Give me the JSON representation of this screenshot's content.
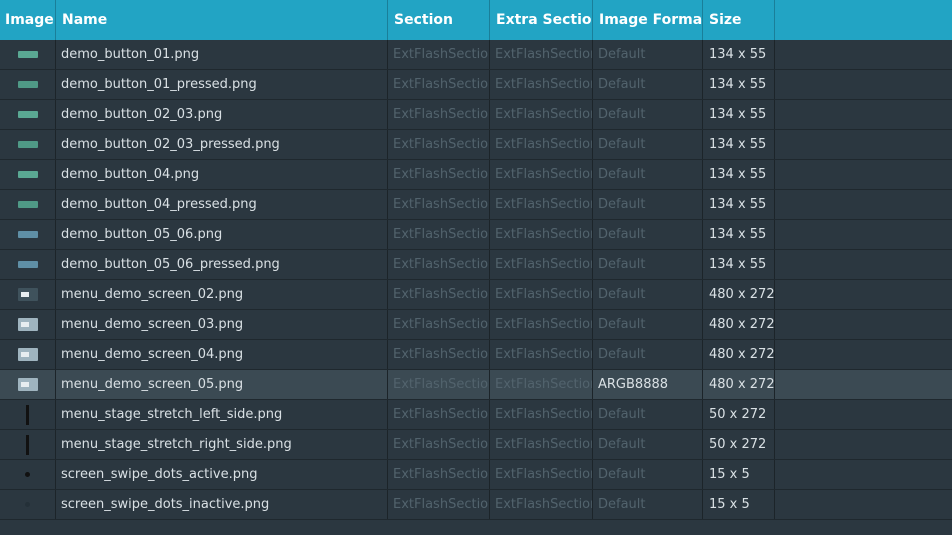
{
  "headers": {
    "image": "Image",
    "name": "Name",
    "section": "Section",
    "extra_section": "Extra Section",
    "image_format": "Image Format",
    "size": "Size"
  },
  "colors": {
    "header_bg": "#22a4c4",
    "row_bg": "#2b3740",
    "selected_row_bg": "#3b4a53",
    "muted_text": "#52636d",
    "text": "#d9e0e4"
  },
  "rows": [
    {
      "thumb": "button-thumbnail",
      "name": "demo_button_01.png",
      "section": "ExtFlashSection",
      "extra_section": "ExtFlashSection",
      "format": "Default",
      "size": "134 x 55"
    },
    {
      "thumb": "button-pressed-thumbnail",
      "name": "demo_button_01_pressed.png",
      "section": "ExtFlashSection",
      "extra_section": "ExtFlashSection",
      "format": "Default",
      "size": "134 x 55"
    },
    {
      "thumb": "button-thumbnail",
      "name": "demo_button_02_03.png",
      "section": "ExtFlashSection",
      "extra_section": "ExtFlashSection",
      "format": "Default",
      "size": "134 x 55"
    },
    {
      "thumb": "button-pressed-thumbnail",
      "name": "demo_button_02_03_pressed.png",
      "section": "ExtFlashSection",
      "extra_section": "ExtFlashSection",
      "format": "Default",
      "size": "134 x 55"
    },
    {
      "thumb": "button-thumbnail",
      "name": "demo_button_04.png",
      "section": "ExtFlashSection",
      "extra_section": "ExtFlashSection",
      "format": "Default",
      "size": "134 x 55"
    },
    {
      "thumb": "button-pressed-thumbnail",
      "name": "demo_button_04_pressed.png",
      "section": "ExtFlashSection",
      "extra_section": "ExtFlashSection",
      "format": "Default",
      "size": "134 x 55"
    },
    {
      "thumb": "button-blue-thumbnail",
      "name": "demo_button_05_06.png",
      "section": "ExtFlashSection",
      "extra_section": "ExtFlashSection",
      "format": "Default",
      "size": "134 x 55"
    },
    {
      "thumb": "button-blue-thumbnail",
      "name": "demo_button_05_06_pressed.png",
      "section": "ExtFlashSection",
      "extra_section": "ExtFlashSection",
      "format": "Default",
      "size": "134 x 55"
    },
    {
      "thumb": "screen-dark-thumbnail",
      "name": "menu_demo_screen_02.png",
      "section": "ExtFlashSection",
      "extra_section": "ExtFlashSection",
      "format": "Default",
      "size": "480 x 272"
    },
    {
      "thumb": "screen-thumbnail",
      "name": "menu_demo_screen_03.png",
      "section": "ExtFlashSection",
      "extra_section": "ExtFlashSection",
      "format": "Default",
      "size": "480 x 272"
    },
    {
      "thumb": "screen-thumbnail",
      "name": "menu_demo_screen_04.png",
      "section": "ExtFlashSection",
      "extra_section": "ExtFlashSection",
      "format": "Default",
      "size": "480 x 272"
    },
    {
      "thumb": "screen-thumbnail",
      "name": "menu_demo_screen_05.png",
      "section": "ExtFlashSection",
      "extra_section": "ExtFlashSection",
      "format": "ARGB8888",
      "size": "480 x 272",
      "selected": true
    },
    {
      "thumb": "stretch-thumbnail",
      "name": "menu_stage_stretch_left_side.png",
      "section": "ExtFlashSection",
      "extra_section": "ExtFlashSection",
      "format": "Default",
      "size": "50 x 272"
    },
    {
      "thumb": "stretch-thumbnail",
      "name": "menu_stage_stretch_right_side.png",
      "section": "ExtFlashSection",
      "extra_section": "ExtFlashSection",
      "format": "Default",
      "size": "50 x 272"
    },
    {
      "thumb": "dot-active-thumbnail",
      "name": "screen_swipe_dots_active.png",
      "section": "ExtFlashSection",
      "extra_section": "ExtFlashSection",
      "format": "Default",
      "size": "15 x 5"
    },
    {
      "thumb": "dot-inactive-thumbnail",
      "name": "screen_swipe_dots_inactive.png",
      "section": "ExtFlashSection",
      "extra_section": "ExtFlashSection",
      "format": "Default",
      "size": "15 x 5"
    }
  ]
}
